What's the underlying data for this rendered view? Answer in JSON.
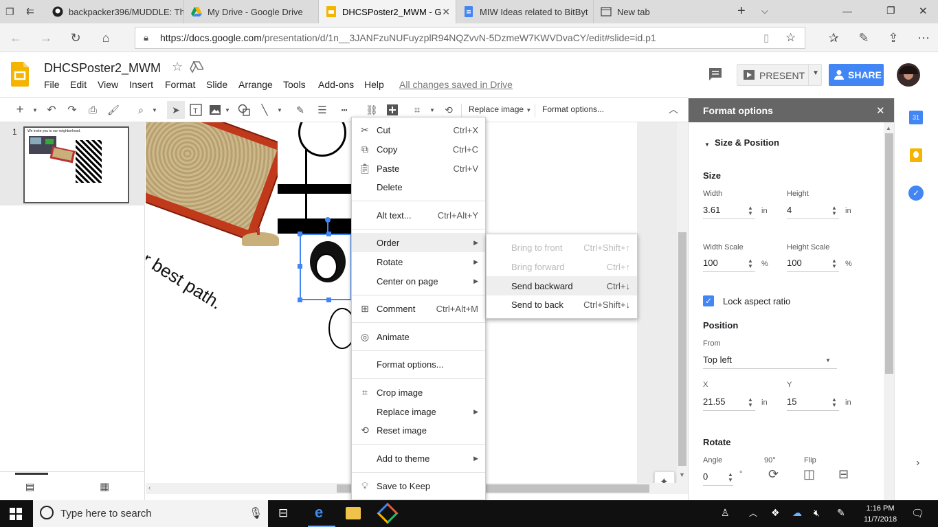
{
  "browser": {
    "tabs": [
      {
        "title": "backpacker396/MUDDLE: Th",
        "icon": "github-icon"
      },
      {
        "title": "My Drive - Google Drive",
        "icon": "drive-icon"
      },
      {
        "title": "DHCSPoster2_MWM - G",
        "icon": "slides-icon",
        "active": true
      },
      {
        "title": "MIW Ideas related to BitByt",
        "icon": "docs-icon"
      },
      {
        "title": "New tab",
        "icon": "newtab-icon"
      }
    ],
    "url_host": "https://docs.google.com",
    "url_path": "/presentation/d/1n__3JANFzuNUFuyzplR94NQZvvN-5DzmeW7KWVDvaCY/edit#slide=id.p1"
  },
  "docs": {
    "title": "DHCSPoster2_MWM",
    "menus": [
      "File",
      "Edit",
      "View",
      "Insert",
      "Format",
      "Slide",
      "Arrange",
      "Tools",
      "Add-ons",
      "Help"
    ],
    "save_status": "All changes saved in Drive",
    "present_label": "PRESENT",
    "share_label": "SHARE"
  },
  "toolbar": {
    "replace_image": "Replace image",
    "format_options": "Format options..."
  },
  "filmstrip": {
    "slide_number": "1",
    "thumb_text": "We invite you to our neighborhood."
  },
  "canvas": {
    "slide_text": "ur best path."
  },
  "context_menu": {
    "items": [
      {
        "label": "Cut",
        "shortcut": "Ctrl+X",
        "icon": "scissors-icon"
      },
      {
        "label": "Copy",
        "shortcut": "Ctrl+C",
        "icon": "copy-icon"
      },
      {
        "label": "Paste",
        "shortcut": "Ctrl+V",
        "icon": "clipboard-icon"
      },
      {
        "label": "Delete",
        "shortcut": ""
      },
      {
        "label": "Alt text...",
        "shortcut": "Ctrl+Alt+Y"
      },
      {
        "label": "Order",
        "submenu": true
      },
      {
        "label": "Rotate",
        "submenu": true
      },
      {
        "label": "Center on page",
        "submenu": true
      },
      {
        "label": "Comment",
        "shortcut": "Ctrl+Alt+M",
        "icon": "comment-add-icon"
      },
      {
        "label": "Animate",
        "icon": "animate-icon"
      },
      {
        "label": "Format options..."
      },
      {
        "label": "Crop image",
        "icon": "crop-icon"
      },
      {
        "label": "Replace image",
        "submenu": true
      },
      {
        "label": "Reset image",
        "icon": "reset-image-icon"
      },
      {
        "label": "Add to theme",
        "submenu": true
      },
      {
        "label": "Save to Keep",
        "icon": "lightbulb-icon"
      }
    ]
  },
  "order_submenu": {
    "items": [
      {
        "label": "Bring to front",
        "shortcut": "Ctrl+Shift+↑",
        "disabled": true
      },
      {
        "label": "Bring forward",
        "shortcut": "Ctrl+↑",
        "disabled": true
      },
      {
        "label": "Send backward",
        "shortcut": "Ctrl+↓",
        "highlighted": true
      },
      {
        "label": "Send to back",
        "shortcut": "Ctrl+Shift+↓"
      }
    ]
  },
  "format_panel": {
    "title": "Format options",
    "section": "Size & Position",
    "size_heading": "Size",
    "width_label": "Width",
    "width_value": "3.61",
    "height_label": "Height",
    "height_value": "4",
    "unit": "in",
    "width_scale_label": "Width Scale",
    "width_scale_value": "100",
    "height_scale_label": "Height Scale",
    "height_scale_value": "100",
    "percent": "%",
    "lock_label": "Lock aspect ratio",
    "lock_checked": true,
    "position_heading": "Position",
    "from_label": "From",
    "from_value": "Top left",
    "x_label": "X",
    "x_value": "21.55",
    "y_label": "Y",
    "y_value": "15",
    "rotate_heading": "Rotate",
    "angle_label": "Angle",
    "angle_value": "0",
    "degree": "°",
    "ninety_label": "90°",
    "flip_label": "Flip"
  },
  "taskbar": {
    "search_placeholder": "Type here to search",
    "time": "1:16 PM",
    "date": "11/7/2018"
  },
  "colors": {
    "accent_blue": "#4285f4",
    "slides_yellow": "#f4b400",
    "panel_header": "#666666",
    "menu_highlight": "#eeeeee"
  }
}
